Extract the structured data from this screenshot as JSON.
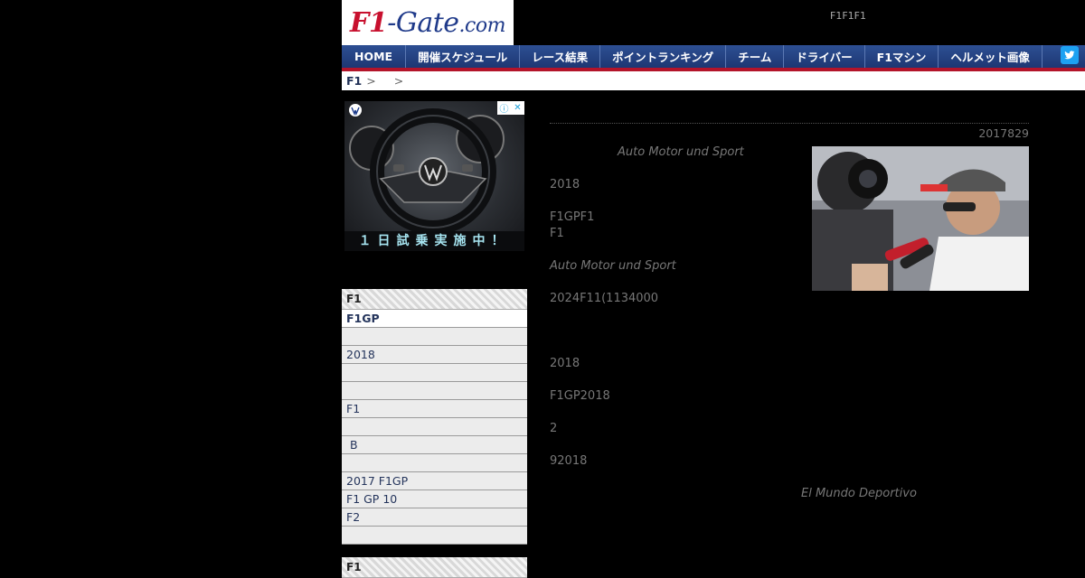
{
  "header": {
    "logo_f1": "F1",
    "logo_rest": "-Gate",
    "logo_com": ".com",
    "tagline": "F1F1F1"
  },
  "nav": {
    "items": [
      "HOME",
      "開催スケジュール",
      "レース結果",
      "ポイントランキング",
      "チーム",
      "ドライバー",
      "F1マシン",
      "ヘルメット画像"
    ],
    "twitter_icon": "twitter-bird-icon",
    "accent": "#b3142a"
  },
  "breadcrumb": {
    "home": "F1",
    "sep1": ">",
    "sep2": ">"
  },
  "ad": {
    "caption": "１日試乗実施中！"
  },
  "sidebar": {
    "heading": "F1",
    "items": [
      "F1GP",
      "",
      "2018",
      "",
      "",
      "F1",
      "",
      " B",
      "",
      "2017 F1GP",
      "F1 GP 10",
      "F2",
      ""
    ],
    "heading2": "F1"
  },
  "article": {
    "date": "2017829",
    "source_1": "Auto Motor und Sport",
    "p1": "2018",
    "p2a": "F1GPF1",
    "p2b": "F1",
    "source_2": "Auto Motor und Sport",
    "p3": "2024F11(1134000",
    "p4": "2018",
    "p5": "F1GP2018",
    "p6": "2",
    "p7": "92018",
    "source_3": "El Mundo Deportivo"
  }
}
